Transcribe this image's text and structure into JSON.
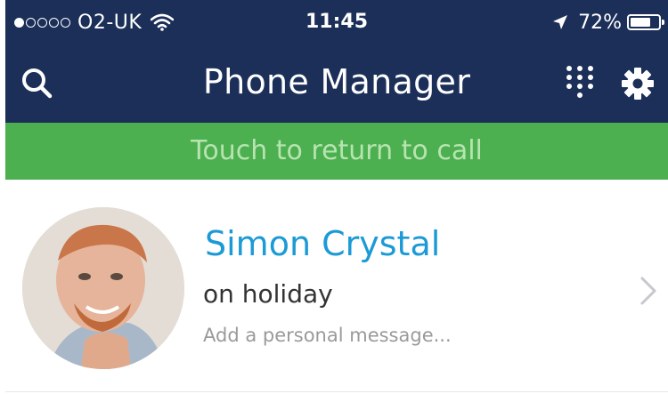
{
  "status_bar": {
    "carrier": "O2-UK",
    "signal_bars_filled": 1,
    "signal_bars_total": 5,
    "time": "11:45",
    "battery_percent": "72%",
    "battery_level": 0.72
  },
  "nav": {
    "title": "Phone Manager",
    "icons": {
      "search": "search-icon",
      "dialpad": "dialpad-icon",
      "settings": "gear-icon"
    }
  },
  "banner": {
    "text": "Touch to return to call"
  },
  "profile": {
    "name": "Simon Crystal",
    "status": "on holiday",
    "message_placeholder": "Add a personal message..."
  },
  "colors": {
    "header_bg": "#1b2f58",
    "banner_bg": "#4caf50",
    "banner_text": "#b7e4b0",
    "name_color": "#1b9ad6"
  }
}
